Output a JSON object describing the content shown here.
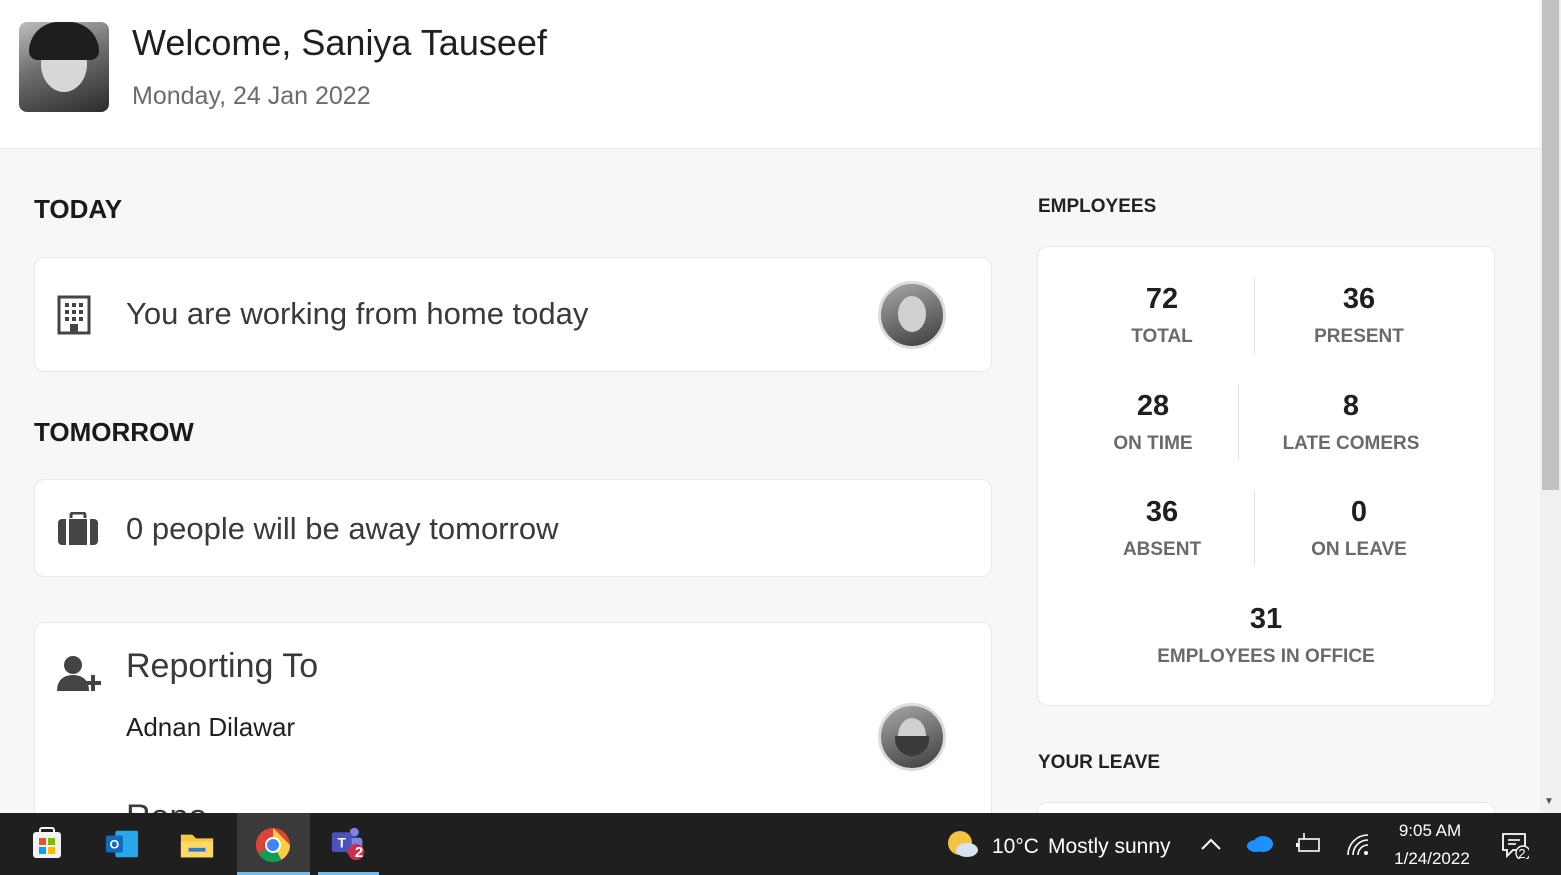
{
  "header": {
    "welcome": "Welcome, Saniya Tauseef",
    "date": "Monday, 24 Jan 2022"
  },
  "today": {
    "title": "TODAY",
    "message": "You are working from home today"
  },
  "tomorrow": {
    "title": "TOMORROW",
    "message": "0 people will be away tomorrow"
  },
  "reporting": {
    "title": "Reporting To",
    "name": "Adnan Dilawar",
    "next_partial": "Repo"
  },
  "employees": {
    "title": "EMPLOYEES",
    "stats": [
      {
        "value": "72",
        "label": "TOTAL"
      },
      {
        "value": "36",
        "label": "PRESENT"
      },
      {
        "value": "28",
        "label": "ON TIME"
      },
      {
        "value": "8",
        "label": "LATE COMERS"
      },
      {
        "value": "36",
        "label": "ABSENT"
      },
      {
        "value": "0",
        "label": "ON LEAVE"
      },
      {
        "value": "31",
        "label": "EMPLOYEES IN OFFICE"
      }
    ]
  },
  "your_leave": {
    "title": "YOUR LEAVE"
  },
  "taskbar": {
    "weather_temp": "10°C",
    "weather_desc": "Mostly sunny",
    "time": "9:05 AM",
    "date": "1/24/2022",
    "teams_badge": "2",
    "notif_badge": "2"
  },
  "icons": [
    "building-icon",
    "briefcase-icon",
    "add-user-icon",
    "windows-start-icon",
    "outlook-icon",
    "file-explorer-icon",
    "chrome-icon",
    "teams-icon",
    "weather-icon",
    "chevron-up-icon",
    "onedrive-icon",
    "battery-icon",
    "wifi-icon",
    "notification-icon"
  ]
}
